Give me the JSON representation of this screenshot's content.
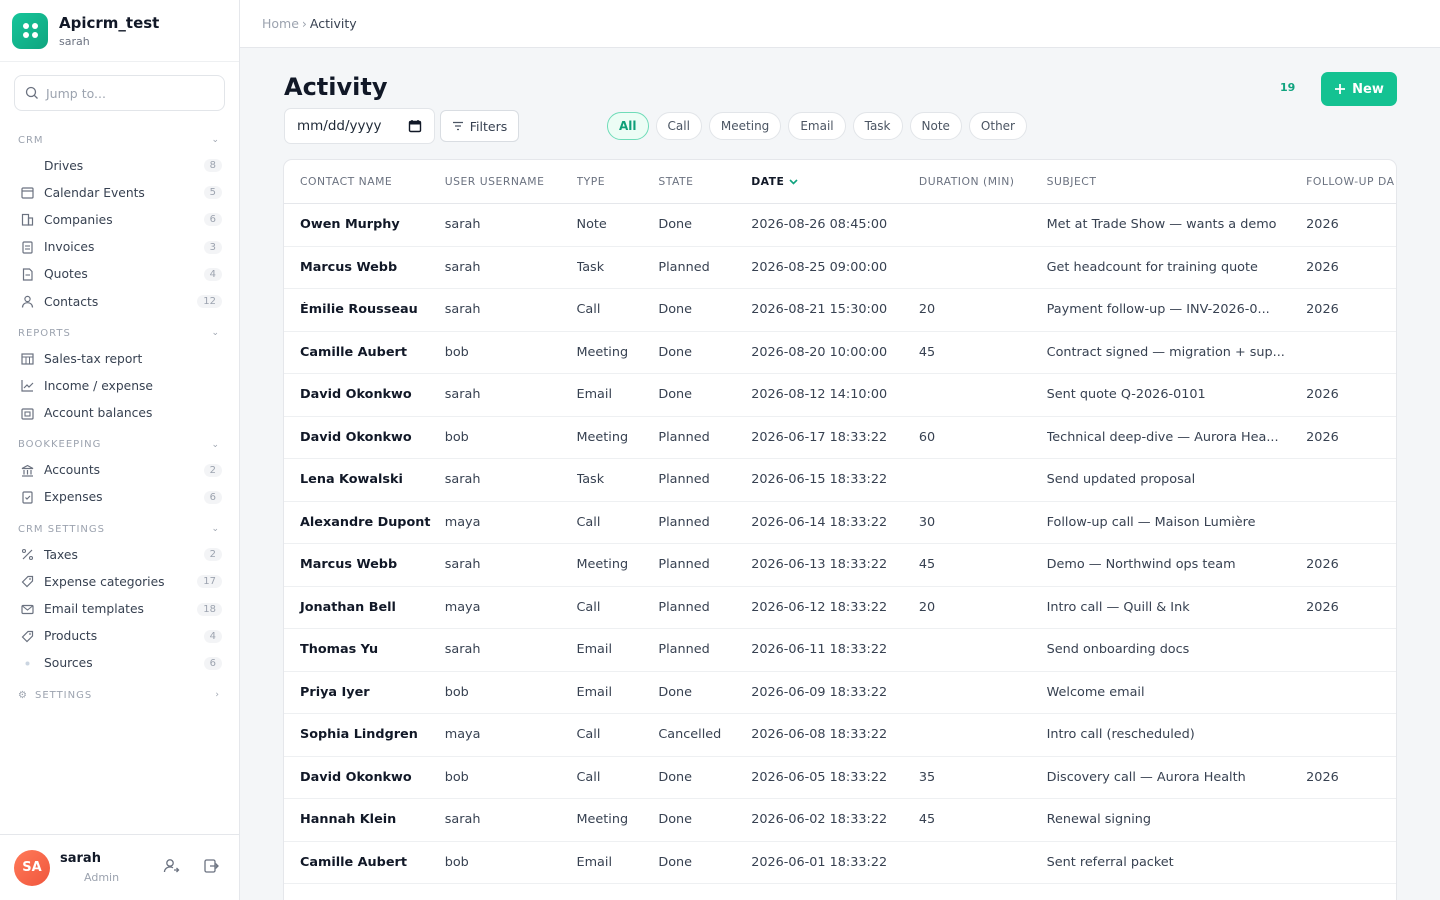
{
  "app": {
    "title": "Apicrm_test",
    "subtitle": "sarah"
  },
  "search": {
    "placeholder": "Jump to..."
  },
  "sidebar": {
    "sections": [
      {
        "title": "CRM",
        "items": [
          {
            "label": "Drives",
            "count": "8",
            "icon": "drive-icon"
          },
          {
            "label": "Calendar Events",
            "count": "5",
            "icon": "calendar-icon"
          },
          {
            "label": "Companies",
            "count": "6",
            "icon": "building-icon"
          },
          {
            "label": "Invoices",
            "count": "3",
            "icon": "invoice-icon"
          },
          {
            "label": "Quotes",
            "count": "4",
            "icon": "quote-icon"
          },
          {
            "label": "Contacts",
            "count": "12",
            "icon": "person-icon"
          }
        ]
      },
      {
        "title": "Reports",
        "items": [
          {
            "label": "Sales-tax report",
            "count": "",
            "icon": "table-icon"
          },
          {
            "label": "Income / expense",
            "count": "",
            "icon": "line-chart-icon"
          },
          {
            "label": "Account balances",
            "count": "",
            "icon": "wallet-icon"
          }
        ]
      },
      {
        "title": "Bookkeeping",
        "items": [
          {
            "label": "Accounts",
            "count": "2",
            "icon": "bank-icon"
          },
          {
            "label": "Expenses",
            "count": "6",
            "icon": "receipt-icon"
          }
        ]
      },
      {
        "title": "CRM Settings",
        "items": [
          {
            "label": "Taxes",
            "count": "2",
            "icon": "percent-icon"
          },
          {
            "label": "Expense categories",
            "count": "17",
            "icon": "tag-icon"
          },
          {
            "label": "Email templates",
            "count": "18",
            "icon": "mail-icon"
          },
          {
            "label": "Products",
            "count": "4",
            "icon": "tag-icon"
          },
          {
            "label": "Sources",
            "count": "6",
            "icon": "dot-icon"
          }
        ]
      }
    ],
    "settings_label": "Settings"
  },
  "user": {
    "initials": "SA",
    "name": "sarah",
    "role": "Admin"
  },
  "breadcrumb": {
    "home": "Home",
    "sep": "›",
    "current": "Activity"
  },
  "page": {
    "title": "Activity",
    "count": "19",
    "new_label": "New"
  },
  "filters": {
    "date_placeholder": "mm/dd/yyyy",
    "filters_label": "Filters",
    "chips": [
      "All",
      "Call",
      "Meeting",
      "Email",
      "Task",
      "Note",
      "Other"
    ],
    "active_chip": "All"
  },
  "table": {
    "columns": [
      "Contact name",
      "User username",
      "Type",
      "State",
      "Date",
      "Duration (min)",
      "Subject",
      "Follow-up da"
    ],
    "sort_column": "Date",
    "rows": [
      [
        "Owen Murphy",
        "sarah",
        "Note",
        "Done",
        "2026-08-26 08:45:00",
        "",
        "Met at Trade Show — wants a demo",
        "2026"
      ],
      [
        "Marcus Webb",
        "sarah",
        "Task",
        "Planned",
        "2026-08-25 09:00:00",
        "",
        "Get headcount for training quote",
        "2026"
      ],
      [
        "Émilie Rousseau",
        "sarah",
        "Call",
        "Done",
        "2026-08-21 15:30:00",
        "20",
        "Payment follow-up — INV-2026-0...",
        "2026"
      ],
      [
        "Camille Aubert",
        "bob",
        "Meeting",
        "Done",
        "2026-08-20 10:00:00",
        "45",
        "Contract signed — migration + sup...",
        ""
      ],
      [
        "David Okonkwo",
        "sarah",
        "Email",
        "Done",
        "2026-08-12 14:10:00",
        "",
        "Sent quote Q-2026-0101",
        "2026"
      ],
      [
        "David Okonkwo",
        "bob",
        "Meeting",
        "Planned",
        "2026-06-17 18:33:22",
        "60",
        "Technical deep-dive — Aurora Hea...",
        "2026"
      ],
      [
        "Lena Kowalski",
        "sarah",
        "Task",
        "Planned",
        "2026-06-15 18:33:22",
        "",
        "Send updated proposal",
        ""
      ],
      [
        "Alexandre Dupont",
        "maya",
        "Call",
        "Planned",
        "2026-06-14 18:33:22",
        "30",
        "Follow-up call — Maison Lumière",
        ""
      ],
      [
        "Marcus Webb",
        "sarah",
        "Meeting",
        "Planned",
        "2026-06-13 18:33:22",
        "45",
        "Demo — Northwind ops team",
        "2026"
      ],
      [
        "Jonathan Bell",
        "maya",
        "Call",
        "Planned",
        "2026-06-12 18:33:22",
        "20",
        "Intro call — Quill & Ink",
        "2026"
      ],
      [
        "Thomas Yu",
        "sarah",
        "Email",
        "Planned",
        "2026-06-11 18:33:22",
        "",
        "Send onboarding docs",
        ""
      ],
      [
        "Priya Iyer",
        "bob",
        "Email",
        "Done",
        "2026-06-09 18:33:22",
        "",
        "Welcome email",
        ""
      ],
      [
        "Sophia Lindgren",
        "maya",
        "Call",
        "Cancelled",
        "2026-06-08 18:33:22",
        "",
        "Intro call (rescheduled)",
        ""
      ],
      [
        "David Okonkwo",
        "bob",
        "Call",
        "Done",
        "2026-06-05 18:33:22",
        "35",
        "Discovery call — Aurora Health",
        "2026"
      ],
      [
        "Hannah Klein",
        "sarah",
        "Meeting",
        "Done",
        "2026-06-02 18:33:22",
        "45",
        "Renewal signing",
        ""
      ],
      [
        "Camille Aubert",
        "bob",
        "Email",
        "Done",
        "2026-06-01 18:33:22",
        "",
        "Sent referral packet",
        ""
      ]
    ]
  },
  "colors": {
    "accent": "#14c292",
    "avatar": "#f0563d"
  }
}
